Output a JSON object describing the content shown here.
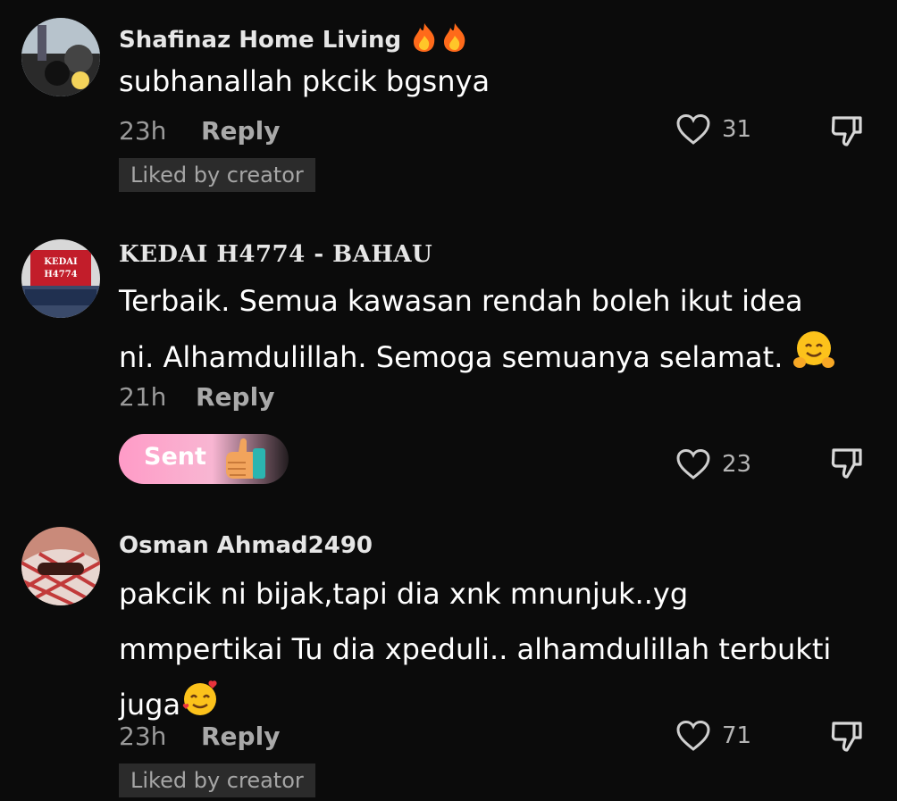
{
  "comments": [
    {
      "username": "Shafinaz Home Living",
      "text_lines": [
        "subhanallah pkcik bgsnya"
      ],
      "time": "23h",
      "reply_label": "Reply",
      "likes": "31",
      "badge": "Liked by creator"
    },
    {
      "username": "KEDAI H4774 - BAHAU",
      "avatar_text": [
        "KEDAI",
        "H4774"
      ],
      "text_lines": [
        "Terbaik. Semua kawasan rendah boleh ikut idea",
        "ni. Alhamdulillah. Semoga semuanya selamat."
      ],
      "time": "21h",
      "reply_label": "Reply",
      "likes": "23",
      "sent_label": "Sent"
    },
    {
      "username": "Osman Ahmad2490",
      "text_lines": [
        "pakcik ni bijak,tapi dia xnk mnunjuk..yg",
        "mmpertikai Tu dia xpeduli.. alhamdulillah terbukti",
        "juga"
      ],
      "time": "23h",
      "reply_label": "Reply",
      "likes": "71",
      "badge": "Liked by creator"
    }
  ],
  "icons": {
    "like": "heart-outline-icon",
    "dislike": "thumbs-down-outline-icon",
    "fire": "fire-emoji",
    "hug": "hugging-face-emoji",
    "love": "smiling-face-with-hearts-emoji",
    "thumbs_up": "thumbs-up-emoji"
  },
  "colors": {
    "background": "#0b0b0b",
    "badge_bg": "#2b2b2b",
    "sent_pill": "#ff9bc7"
  }
}
